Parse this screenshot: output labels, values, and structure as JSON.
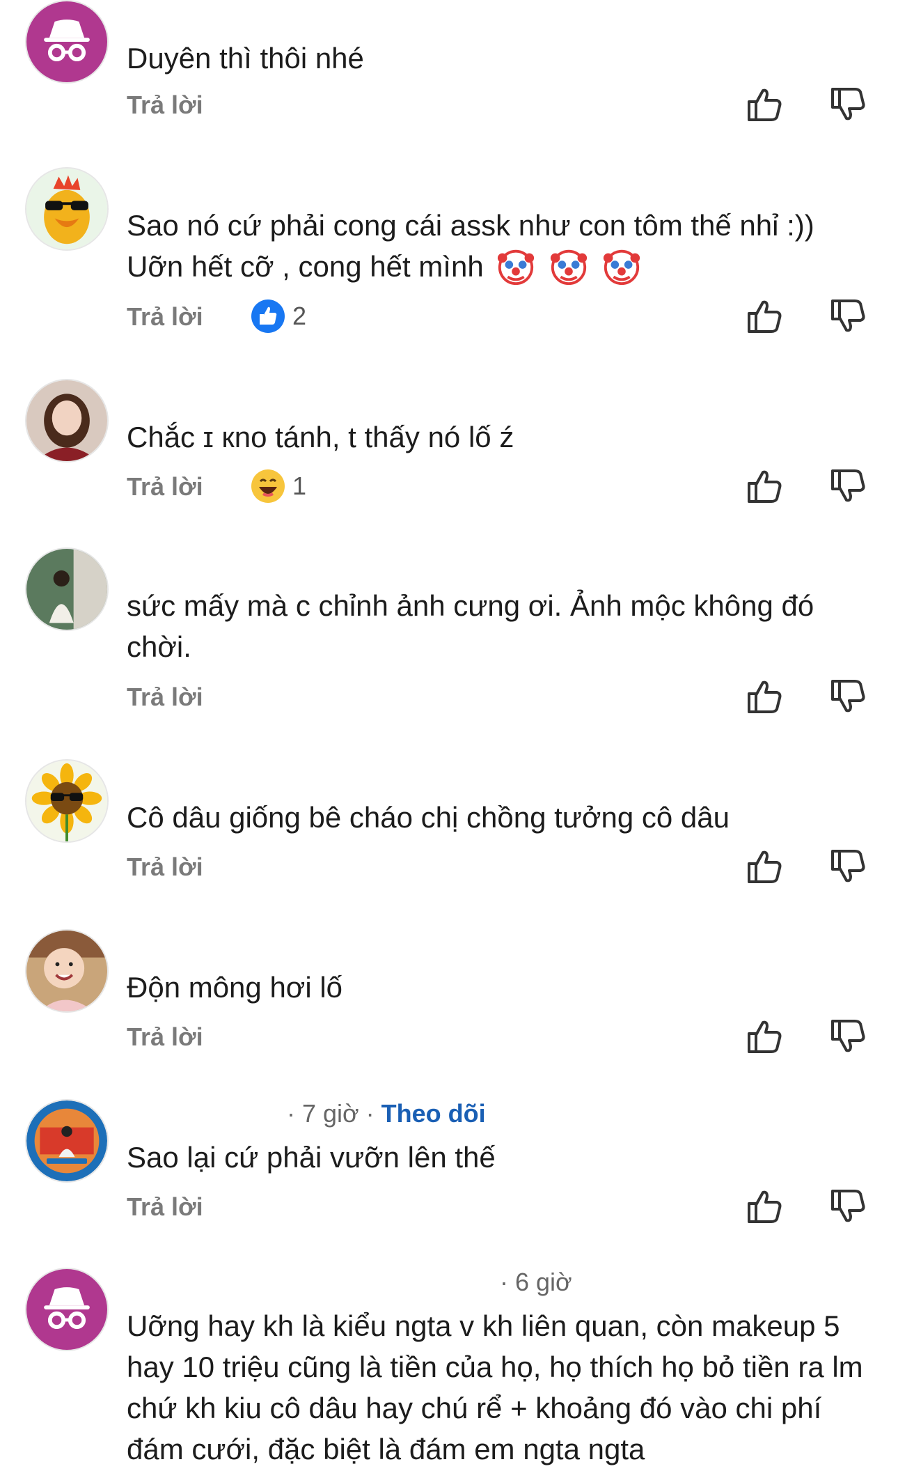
{
  "comments": [
    {
      "avatar": "incognito-icon",
      "meta": "",
      "follow": "",
      "text": "Duyên thì thôi nhé",
      "reply_label": "Trả lời",
      "reaction_count": ""
    },
    {
      "avatar": "duck-sunglasses-avatar",
      "meta": "",
      "follow": "",
      "text": "Sao nó cứ phải cong cái assk như con tôm thế nhỉ :)) Uỡn hết cỡ , cong hết mình",
      "emojis": [
        "clown-face-emoji",
        "clown-face-emoji",
        "clown-face-emoji"
      ],
      "reply_label": "Trả lời",
      "reaction_icon": "like-reaction-icon",
      "reaction_count": "2"
    },
    {
      "avatar": "woman-photo-avatar",
      "meta": "",
      "follow": "",
      "text": "Chắc ɪ кno tánh, t thấy nó lố ź",
      "reply_label": "Trả lời",
      "reaction_icon": "laughing-reaction-icon",
      "reaction_count": "1"
    },
    {
      "avatar": "woman-room-photo-avatar",
      "meta": "",
      "follow": "",
      "text": "sức mấy mà c chỉnh ảnh cưng ơi. Ảnh mộc không đó chời.",
      "reply_label": "Trả lời",
      "reaction_count": ""
    },
    {
      "avatar": "sunflower-sunglasses-avatar",
      "meta": "",
      "follow": "",
      "text": "Cô dâu giống bê cháo chị chồng tưởng cô dâu",
      "reply_label": "Trả lời",
      "reaction_count": ""
    },
    {
      "avatar": "baby-photo-avatar",
      "meta": "",
      "follow": "",
      "text": "Độn mông hơi lố",
      "reply_label": "Trả lời",
      "reaction_count": ""
    },
    {
      "avatar": "graduation-badge-avatar",
      "meta": "· 7 giờ ·",
      "follow": "Theo dõi",
      "text": "Sao lại cứ phải vưỡn lên thế",
      "reply_label": "Trả lời",
      "reaction_count": ""
    },
    {
      "avatar": "incognito-icon",
      "meta": "· 6 giờ",
      "follow": "",
      "text": "Uỡng hay kh là kiểu ngta v kh liên quan, còn makeup 5 hay 10 triệu cũng là tiền của họ, họ thích họ bỏ tiền ra lm chứ kh kiu cô dâu hay chú rể + khoảng đó vào chi phí đám cưới, đặc biệt là đám em ngta ngta",
      "reply_label": "",
      "reaction_count": ""
    }
  ],
  "colors": {
    "incognito_bg": "#b0388f",
    "follow_link": "#1a5fb4",
    "like_blue": "#1877f2"
  }
}
